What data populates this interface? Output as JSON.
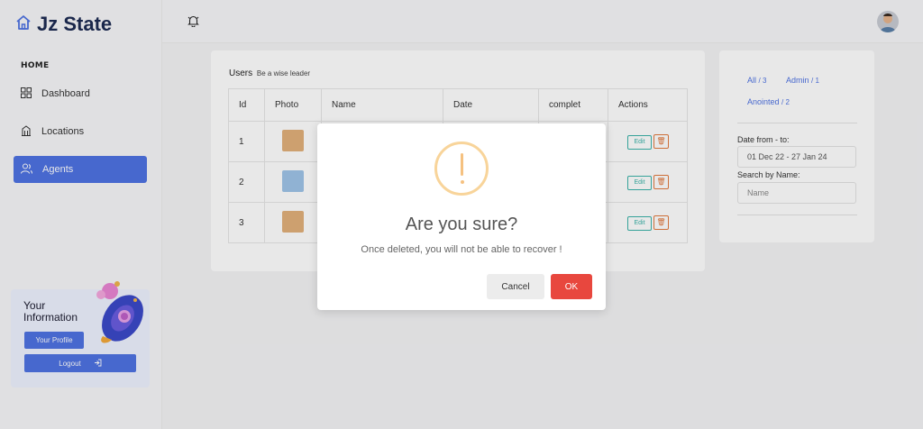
{
  "app": {
    "brand": "Jz State"
  },
  "sidebar": {
    "section_label": "HOME",
    "items": [
      {
        "label": "Dashboard",
        "icon": "dashboard-icon"
      },
      {
        "label": "Locations",
        "icon": "building-icon"
      },
      {
        "label": "Agents",
        "icon": "users-icon",
        "active": true
      }
    ],
    "info_card": {
      "title": "Your Information",
      "profile_button": "Your Profile",
      "logout_button": "Logout"
    }
  },
  "header": {
    "bell_icon": "bell-icon",
    "avatar": "user-avatar"
  },
  "users_table": {
    "title": "Users",
    "subtitle": "Be a wise leader",
    "columns": [
      "Id",
      "Photo",
      "Name",
      "Date",
      "complet",
      "Actions"
    ],
    "rows": [
      {
        "id": "1",
        "edit": "Edit"
      },
      {
        "id": "2",
        "edit": "Edit"
      },
      {
        "id": "3",
        "edit": "Edit"
      }
    ]
  },
  "filters": {
    "tabs": [
      {
        "label": "All",
        "count": "/ 3"
      },
      {
        "label": "Admin",
        "count": "/ 1"
      },
      {
        "label": "Anointed",
        "count": "/ 2"
      }
    ],
    "date_label": "Date from - to:",
    "date_value": "01 Dec 22 - 27 Jan 24",
    "search_label": "Search by Name:",
    "search_placeholder": "Name"
  },
  "modal": {
    "title": "Are you sure?",
    "text": "Once deleted, you will not be able to recover !",
    "cancel": "Cancel",
    "ok": "OK"
  },
  "colors": {
    "accent": "#4f73e3",
    "danger": "#e8473e",
    "warning": "#f8d49a"
  }
}
